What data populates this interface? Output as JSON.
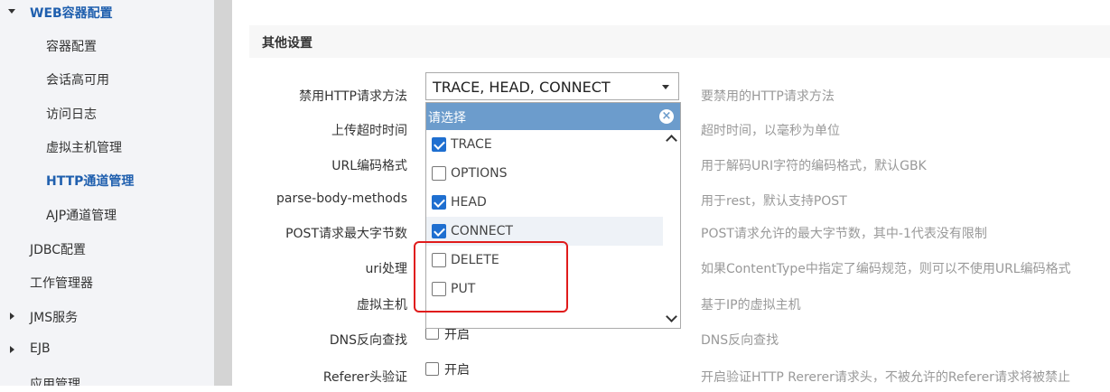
{
  "sidebar": {
    "items": [
      {
        "label": "WEB容器配置"
      },
      {
        "label": "容器配置"
      },
      {
        "label": "会话高可用"
      },
      {
        "label": "访问日志"
      },
      {
        "label": "虚拟主机管理"
      },
      {
        "label": "HTTP通道管理"
      },
      {
        "label": "AJP通道管理"
      },
      {
        "label": "JDBC配置"
      },
      {
        "label": "工作管理器"
      },
      {
        "label": "JMS服务"
      },
      {
        "label": "EJB"
      },
      {
        "label": "应用管理"
      }
    ]
  },
  "section": {
    "title": "其他设置"
  },
  "rows": [
    {
      "label": "禁用HTTP请求方法",
      "desc": "要禁用的HTTP请求方法"
    },
    {
      "label": "上传超时时间",
      "desc": "超时时间，以毫秒为单位"
    },
    {
      "label": "URL编码格式",
      "desc": "用于解码URI字符的编码格式，默认GBK"
    },
    {
      "label": "parse-body-methods",
      "desc": "用于rest，默认支持POST"
    },
    {
      "label": "POST请求最大字节数",
      "desc": "POST请求允许的最大字节数，其中-1代表没有限制"
    },
    {
      "label": "uri处理",
      "desc": "如果ContentType中指定了编码规范，则可以不使用URL编码格式"
    },
    {
      "label": "虚拟主机",
      "desc": "基于IP的虚拟主机"
    },
    {
      "label": "DNS反向查找",
      "desc": "DNS反向查找",
      "cb": "开启"
    },
    {
      "label": "Referer头验证",
      "desc": "开启验证HTTP Rererer请求头，不被允许的Referer请求将被禁止",
      "cb": "开启"
    }
  ],
  "select": {
    "value": "TRACE, HEAD, CONNECT"
  },
  "dropdown": {
    "placeholder": "请选择",
    "options": [
      {
        "label": "TRACE",
        "checked": true
      },
      {
        "label": "OPTIONS",
        "checked": false
      },
      {
        "label": "HEAD",
        "checked": true
      },
      {
        "label": "CONNECT",
        "checked": true
      },
      {
        "label": "DELETE",
        "checked": false
      },
      {
        "label": "PUT",
        "checked": false
      }
    ]
  },
  "colors": {
    "accent": "#1f5fae",
    "dropdown_header": "#6c9ccc",
    "checkbox_on": "#1f6fd0",
    "highlight": "#e01b1b"
  }
}
